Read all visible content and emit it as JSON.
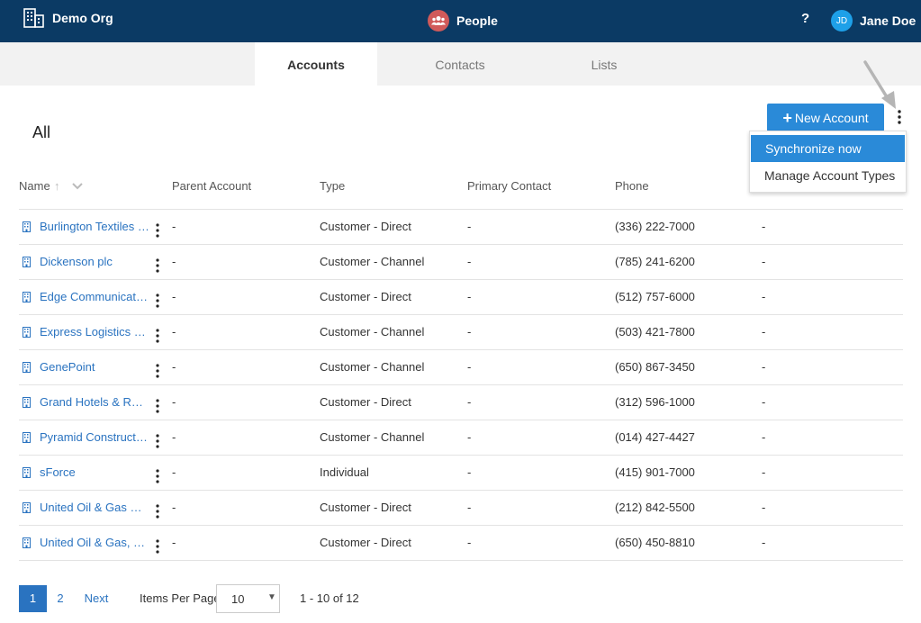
{
  "topbar": {
    "org_name": "Demo Org",
    "app_name": "People",
    "help_label": "?",
    "user_initials": "JD",
    "user_name": "Jane Doe"
  },
  "tabs": [
    {
      "label": "Accounts",
      "active": true
    },
    {
      "label": "Contacts",
      "active": false
    },
    {
      "label": "Lists",
      "active": false
    }
  ],
  "view_title": "All",
  "new_button": {
    "plus": "+",
    "label": "New Account"
  },
  "menu": {
    "items": [
      "Synchronize now",
      "Manage Account Types"
    ],
    "highlighted": "Synchronize now"
  },
  "table": {
    "headers": [
      "Name",
      "Parent Account",
      "Type",
      "Primary Contact",
      "Phone"
    ],
    "sort_indicator": "↑",
    "rows": [
      {
        "name": "Burlington Textiles Corp of America",
        "parent": "-",
        "type": "Customer - Direct",
        "contact": "-",
        "phone": "(336) 222-7000",
        "extra": "-"
      },
      {
        "name": "Dickenson plc",
        "parent": "-",
        "type": "Customer - Channel",
        "contact": "-",
        "phone": "(785) 241-6200",
        "extra": "-"
      },
      {
        "name": "Edge Communications",
        "parent": "-",
        "type": "Customer - Direct",
        "contact": "-",
        "phone": "(512) 757-6000",
        "extra": "-"
      },
      {
        "name": "Express Logistics and Transport",
        "parent": "-",
        "type": "Customer - Channel",
        "contact": "-",
        "phone": "(503) 421-7800",
        "extra": "-"
      },
      {
        "name": "GenePoint",
        "parent": "-",
        "type": "Customer - Channel",
        "contact": "-",
        "phone": "(650) 867-3450",
        "extra": "-"
      },
      {
        "name": "Grand Hotels & Resorts Ltd",
        "parent": "-",
        "type": "Customer - Direct",
        "contact": "-",
        "phone": "(312) 596-1000",
        "extra": "-"
      },
      {
        "name": "Pyramid Construction Inc.",
        "parent": "-",
        "type": "Customer - Channel",
        "contact": "-",
        "phone": "(014) 427-4427",
        "extra": "-"
      },
      {
        "name": "sForce",
        "parent": "-",
        "type": "Individual",
        "contact": "-",
        "phone": "(415) 901-7000",
        "extra": "-"
      },
      {
        "name": "United Oil & Gas Corp.",
        "parent": "-",
        "type": "Customer - Direct",
        "contact": "-",
        "phone": "(212) 842-5500",
        "extra": "-"
      },
      {
        "name": "United Oil & Gas, Singapore",
        "parent": "-",
        "type": "Customer - Direct",
        "contact": "-",
        "phone": "(650) 450-8810",
        "extra": "-"
      }
    ]
  },
  "pagination": {
    "pages": [
      "1",
      "2"
    ],
    "current": "1",
    "next_label": "Next",
    "items_per_page_label": "Items Per Page",
    "items_per_page_value": "10",
    "range_text": "1 - 10 of 12"
  },
  "colors": {
    "topbar": "#0b3a64",
    "accent": "#2a8ad8",
    "link": "#2a73c0",
    "app_icon": "#d05a5a",
    "avatar": "#1ea0e8"
  }
}
